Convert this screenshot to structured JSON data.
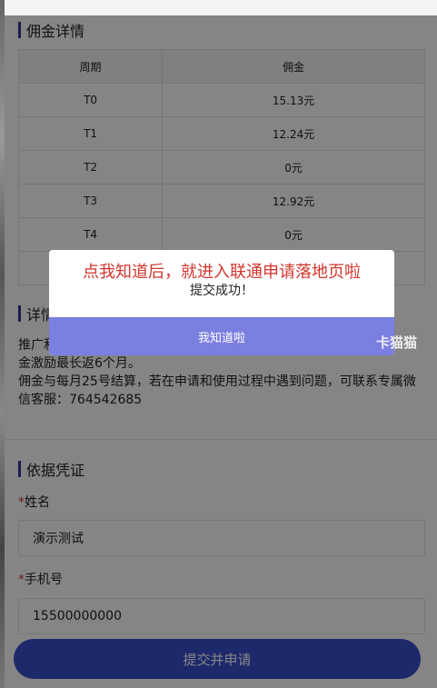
{
  "commission": {
    "title": "佣金详情",
    "headers": [
      "周期",
      "佣金"
    ],
    "rows": [
      {
        "period": "T0",
        "amount": "15.13元"
      },
      {
        "period": "T1",
        "amount": "12.24元"
      },
      {
        "period": "T2",
        "amount": "0元"
      },
      {
        "period": "T3",
        "amount": "12.92元"
      },
      {
        "period": "T4",
        "amount": "0元"
      },
      {
        "period": "",
        "amount": ""
      }
    ]
  },
  "details": {
    "title": "详情",
    "line1": "推广和",
    "line2": "金激励最长返6个月。",
    "line3": "佣金与每月25号结算，若在申请和使用过程中遇到问题，可联系专属微信客服：764542685"
  },
  "form": {
    "title": "依据凭证",
    "name_label": "姓名",
    "name_value": "演示测试",
    "phone_label": "手机号",
    "phone_value": "15500000000",
    "required_mark": "*",
    "submit_label": "提交并申请"
  },
  "modal": {
    "annotation": "点我知道后，就进入联通申请落地页啦",
    "message": "提交成功！",
    "button_label": "我知道啦"
  },
  "watermark": {
    "text": "卡猫猫"
  }
}
